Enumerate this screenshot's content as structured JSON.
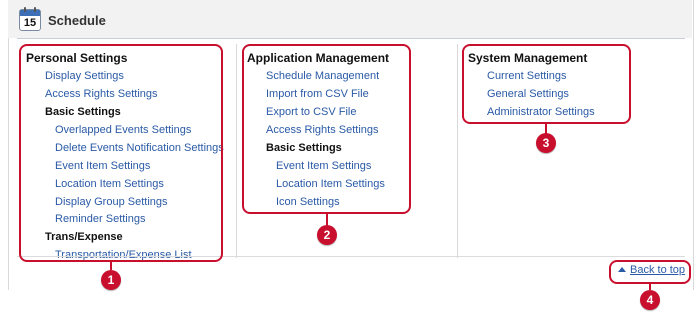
{
  "header": {
    "title": "Schedule",
    "calendar_day": "15"
  },
  "personal": {
    "heading": "Personal Settings",
    "display": "Display Settings",
    "access": "Access Rights Settings",
    "basic": "Basic Settings",
    "overlapped": "Overlapped Events Settings",
    "delete_notif": "Delete Events Notification Settings",
    "event_item": "Event Item Settings",
    "location_item": "Location Item Settings",
    "display_group": "Display Group Settings",
    "reminder": "Reminder Settings",
    "trans": "Trans/Expense",
    "trans_list": "Transportation/Expense List"
  },
  "application": {
    "heading": "Application Management",
    "schedule_mgmt": "Schedule Management",
    "import_csv": "Import from CSV File",
    "export_csv": "Export to CSV File",
    "access": "Access Rights Settings",
    "basic": "Basic Settings",
    "event_item": "Event Item Settings",
    "location_item": "Location Item Settings",
    "icon": "Icon Settings"
  },
  "system": {
    "heading": "System Management",
    "current": "Current Settings",
    "general": "General Settings",
    "admin": "Administrator Settings"
  },
  "footer": {
    "back_to_top": "Back to top"
  },
  "callouts": {
    "c1": "1",
    "c2": "2",
    "c3": "3",
    "c4": "4"
  },
  "colors": {
    "callout": "#c8102e",
    "link": "#2a5aa6",
    "header_bg": "#f2f2f2"
  }
}
